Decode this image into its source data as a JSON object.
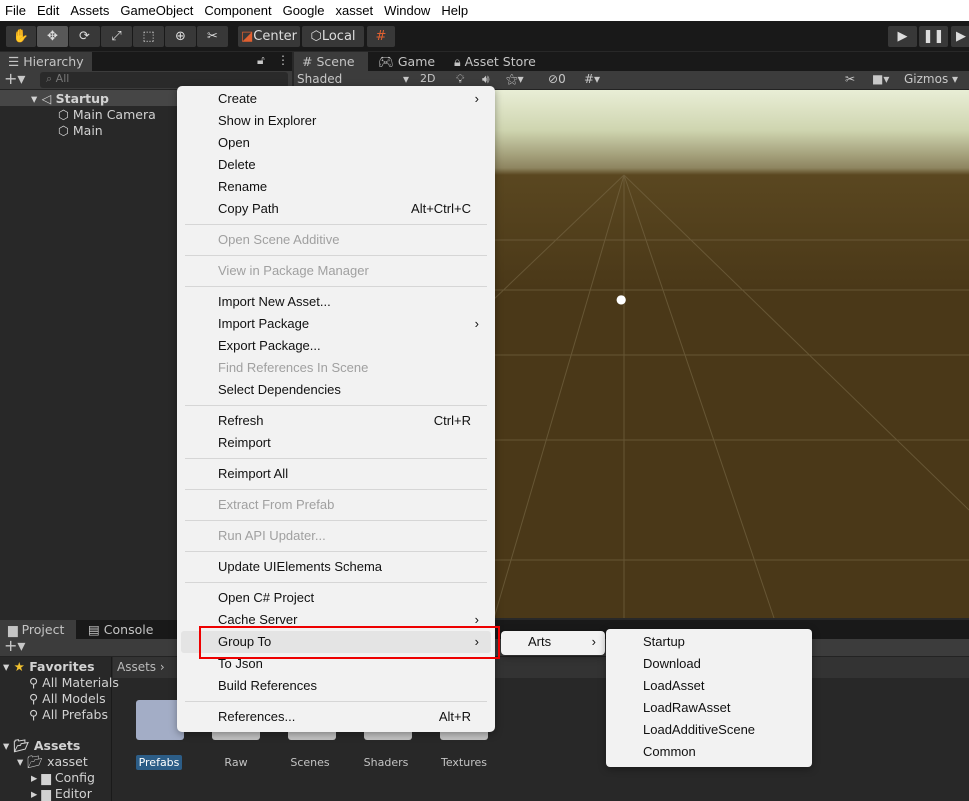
{
  "menubar": [
    "File",
    "Edit",
    "Assets",
    "GameObject",
    "Component",
    "Google",
    "xasset",
    "Window",
    "Help"
  ],
  "toolbar": {
    "pivot": "Center",
    "space": "Local"
  },
  "hierarchy": {
    "tab": "Hierarchy",
    "search_placeholder": "All",
    "scene": "Startup",
    "children": [
      "Main Camera",
      "Main"
    ]
  },
  "scene_tabs": [
    "Scene",
    "Game",
    "Asset Store"
  ],
  "scene_toolbar": {
    "shading": "Shaded",
    "mode2d": "2D",
    "hidden_count": "0",
    "gizmos": "Gizmos"
  },
  "project": {
    "tabs": [
      "Project",
      "Console"
    ],
    "favorites": "Favorites",
    "fav_items": [
      "All Materials",
      "All Models",
      "All Prefabs"
    ],
    "assets": "Assets",
    "tree": [
      "xasset",
      "Config",
      "Editor"
    ],
    "breadcrumb": "Assets",
    "folders": [
      "Prefabs",
      "Raw",
      "Scenes",
      "Shaders",
      "Textures"
    ],
    "selected_folder": "Prefabs"
  },
  "context_menu": [
    {
      "label": "Create",
      "submenu": true
    },
    {
      "label": "Show in Explorer"
    },
    {
      "label": "Open"
    },
    {
      "label": "Delete"
    },
    {
      "label": "Rename"
    },
    {
      "label": "Copy Path",
      "shortcut": "Alt+Ctrl+C"
    },
    {
      "separator": true
    },
    {
      "label": "Open Scene Additive",
      "disabled": true
    },
    {
      "separator": true
    },
    {
      "label": "View in Package Manager",
      "disabled": true
    },
    {
      "separator": true
    },
    {
      "label": "Import New Asset..."
    },
    {
      "label": "Import Package",
      "submenu": true
    },
    {
      "label": "Export Package..."
    },
    {
      "label": "Find References In Scene",
      "disabled": true
    },
    {
      "label": "Select Dependencies"
    },
    {
      "separator": true
    },
    {
      "label": "Refresh",
      "shortcut": "Ctrl+R"
    },
    {
      "label": "Reimport"
    },
    {
      "separator": true
    },
    {
      "label": "Reimport All"
    },
    {
      "separator": true
    },
    {
      "label": "Extract From Prefab",
      "disabled": true
    },
    {
      "separator": true
    },
    {
      "label": "Run API Updater...",
      "disabled": true
    },
    {
      "separator": true
    },
    {
      "label": "Update UIElements Schema"
    },
    {
      "separator": true
    },
    {
      "label": "Open C# Project"
    },
    {
      "label": "Cache Server",
      "submenu": true
    },
    {
      "label": "Group To",
      "submenu": true,
      "highlighted": true
    },
    {
      "label": "To Json"
    },
    {
      "label": "Build References"
    },
    {
      "separator": true
    },
    {
      "label": "References...",
      "shortcut": "Alt+R"
    }
  ],
  "submenu1": {
    "label": "Arts"
  },
  "submenu2": [
    "Startup",
    "Download",
    "LoadAsset",
    "LoadRawAsset",
    "LoadAdditiveScene",
    "Common"
  ],
  "colors": {
    "highlight_box": "#ee0000",
    "menu_bg": "#f2f2f2",
    "editor_bg": "#282828"
  }
}
